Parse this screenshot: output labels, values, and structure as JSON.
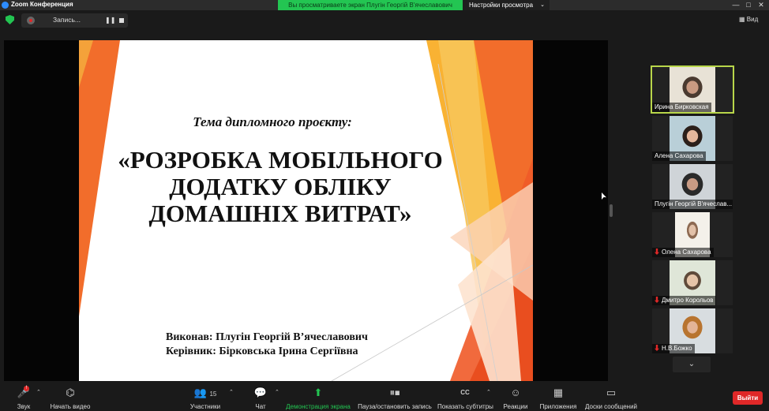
{
  "window": {
    "title": "Zoom Конференция",
    "share_banner": "Вы просматриваете экран Плугін Георгій В'ячеславович",
    "view_options": "Настройки просмотра",
    "view_button": "Вид"
  },
  "recording": {
    "label": "Запись...",
    "pause_icon": "pause-icon",
    "stop_icon": "stop-icon"
  },
  "slide": {
    "topic": "Тема дипломного проєкту:",
    "title": "«РОЗРОБКА МОБІЛЬНОГО ДОДАТКУ ОБЛІКУ ДОМАШНІХ ВИТРАТ»",
    "author": "Виконав: Плугін Георгій В’ячеславович",
    "supervisor": "Керівник: Бірковська Ірина Сергіївна"
  },
  "participants": [
    {
      "name": "Ирина Бирковская",
      "muted": false,
      "active": true
    },
    {
      "name": "Алена Сахарова",
      "muted": false,
      "active": false
    },
    {
      "name": "Плугін Георгій В'ячеслав...",
      "muted": false,
      "active": false
    },
    {
      "name": "Олена Сахарова",
      "muted": true,
      "active": false
    },
    {
      "name": "Дмитро Корольов",
      "muted": true,
      "active": false
    },
    {
      "name": "Н.В.Божко",
      "muted": true,
      "active": false
    }
  ],
  "toolbar": {
    "audio": "Звук",
    "video": "Начать видео",
    "participants": "Участники",
    "participants_count": "15",
    "chat": "Чат",
    "share": "Демонстрация экрана",
    "record": "Пауза/остановить запись",
    "captions": "Показать субтитры",
    "reactions": "Реакции",
    "apps": "Приложения",
    "whiteboards": "Доски сообщений",
    "leave": "Выйти"
  },
  "colors": {
    "accent_green": "#23c552",
    "leave_red": "#e02828",
    "active_speaker": "#b8d64a",
    "slide_orange": "#f26d2b",
    "slide_yellow": "#f9b233"
  }
}
